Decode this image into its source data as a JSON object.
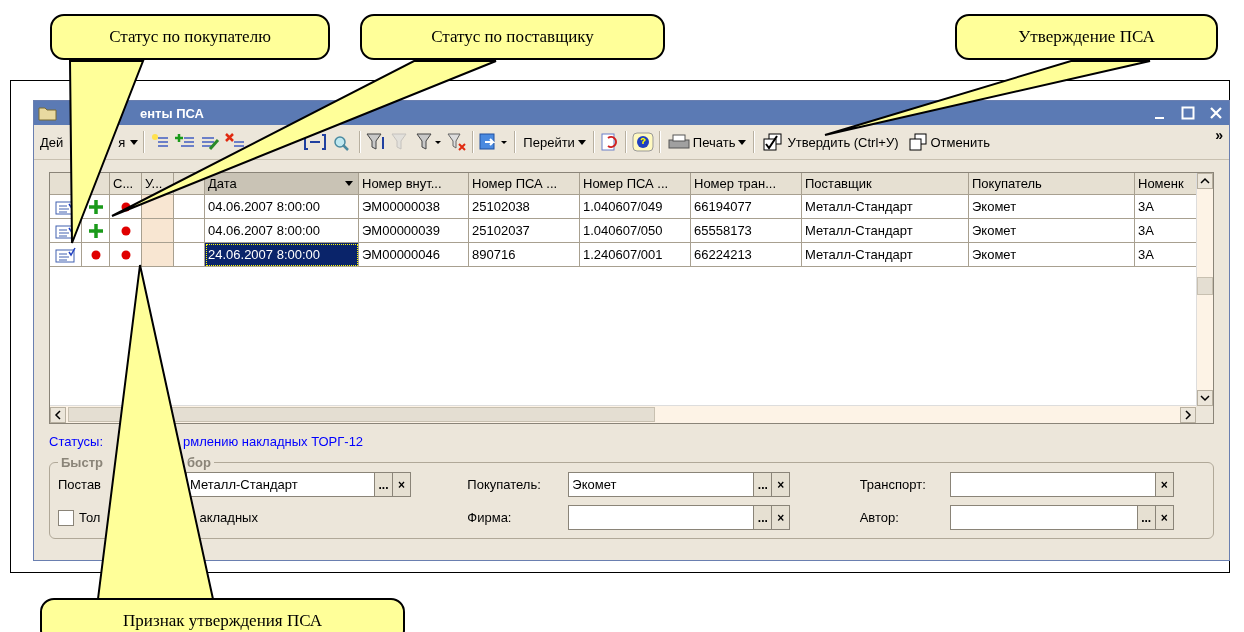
{
  "callouts": [
    {
      "text": "Статус по покупателю"
    },
    {
      "text": "Статус по поставщику"
    },
    {
      "text": "Утверждение ПСА"
    },
    {
      "text": "Признак утверждения ПСА"
    }
  ],
  "window": {
    "title": "енты ПСА"
  },
  "toolbar": {
    "actions_menu_start": "Дей",
    "actions_menu_end": "я",
    "goto_menu": "Перейти",
    "print_menu": "Печать",
    "approve_button": "Утвердить (Ctrl+У)",
    "cancel_button": "Отменить",
    "more": "»"
  },
  "table": {
    "columns": [
      "С...",
      "У...",
      "Дата",
      "Номер внут...",
      "Номер ПСА ...",
      "Номер ПСА ...",
      "Номер тран...",
      "Поставщик",
      "Покупатель",
      "Номенк"
    ],
    "rows": [
      {
        "buyer_status": {
          "kind": "plus"
        },
        "supplier_status": {
          "kind": "dot"
        },
        "date": "04.06.2007 8:00:00",
        "internal_number": "ЭМ00000038",
        "psa_number": "25102038",
        "psa_number_2": "1.040607/049",
        "transport_number": "66194077",
        "supplier": "Металл-Стандарт",
        "buyer": "Экомет",
        "item": "3А",
        "selected": false
      },
      {
        "buyer_status": {
          "kind": "plus"
        },
        "supplier_status": {
          "kind": "dot"
        },
        "date": "04.06.2007 8:00:00",
        "internal_number": "ЭМ00000039",
        "psa_number": "25102037",
        "psa_number_2": "1.040607/050",
        "transport_number": "65558173",
        "supplier": "Металл-Стандарт",
        "buyer": "Экомет",
        "item": "3А",
        "selected": false
      },
      {
        "buyer_status": {
          "kind": "dot"
        },
        "supplier_status": {
          "kind": "dot"
        },
        "date": "24.06.2007 8:00:00",
        "internal_number": "ЭМ00000046",
        "psa_number": "890716",
        "psa_number_2": "1.240607/001",
        "transport_number": "66224213",
        "supplier": "Металл-Стандарт",
        "buyer": "Экомет",
        "item": "3А",
        "selected": true
      }
    ]
  },
  "status_link": {
    "start": "Статусы:",
    "end": "рмлению накладных ТОРГ-12"
  },
  "quick_filter": {
    "title_start": "Быстр",
    "title_end": "бор",
    "fields": [
      {
        "label": "Постав",
        "value": "Металл-Стандарт",
        "buttons": [
          "...",
          "×"
        ]
      },
      {
        "label": "Покупатель:",
        "value": "Экомет",
        "buttons": [
          "...",
          "×"
        ]
      },
      {
        "label": "Транспорт:",
        "buttons": [
          "×"
        ]
      },
      {
        "label": "Фирма:",
        "buttons": [
          "...",
          "×"
        ]
      },
      {
        "label": "Автор:",
        "buttons": [
          "...",
          "×"
        ]
      }
    ],
    "checkbox": {
      "label_start": "Тол",
      "label_end": "акладных",
      "checked": false
    }
  }
}
